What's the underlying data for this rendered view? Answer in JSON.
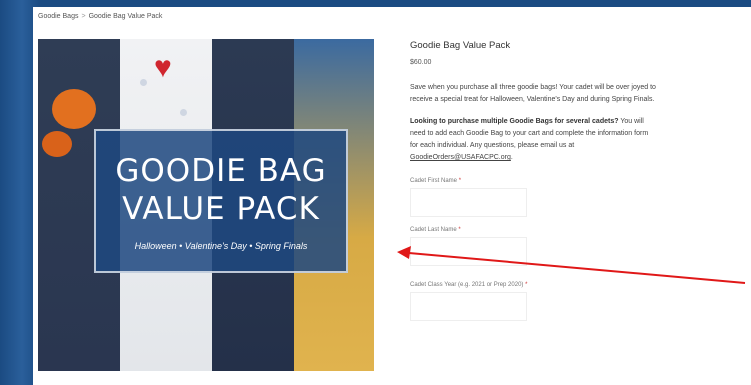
{
  "breadcrumb": {
    "home": "Goodie Bags",
    "separator": ">",
    "current": "Goodie Bag Value Pack"
  },
  "hero": {
    "title_line1": "GOODIE BAG",
    "title_line2": "VALUE PACK",
    "subtitle": "Halloween • Valentine's Day • Spring Finals"
  },
  "product": {
    "title": "Goodie Bag Value Pack",
    "price": "$60.00",
    "description_line1": "Save when you purchase all three goodie bags! Your cadet will be over joyed to",
    "description_line2": "receive a special treat for Halloween, Valentine's Day and during Spring Finals.",
    "multi_bold": "Looking to purchase multiple Goodie Bags for several cadets?",
    "multi_rest": " You will",
    "multi_line2": "need to add each Goodie Bag to your cart and complete the information form",
    "multi_line3": "for each individual. Any questions, please email us at",
    "email": "GoodieOrders@USAFACPC.org",
    "email_suffix": "."
  },
  "form": {
    "first_name_label": "Cadet First Name",
    "last_name_label": "Cadet Last Name",
    "class_year_label": "Cadet Class Year (e.g. 2021 or Prep 2020)",
    "required_mark": "*"
  },
  "colors": {
    "arrow": "#e01818",
    "overlay": "#1e4880"
  }
}
